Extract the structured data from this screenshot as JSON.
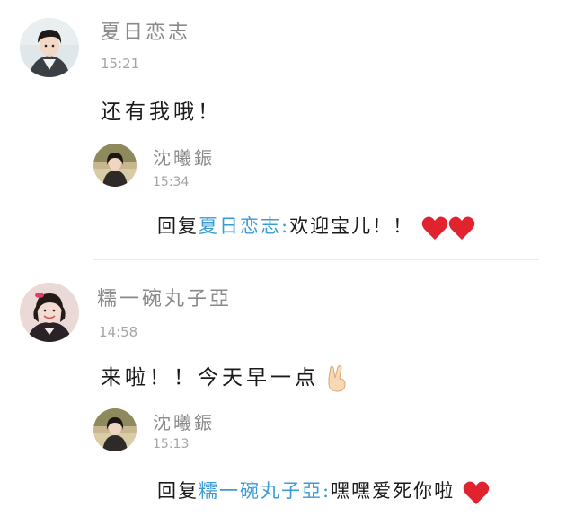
{
  "comments": [
    {
      "author": "夏日恋志",
      "time": "15:21",
      "text": "还有我哦！",
      "avatar": "avatar-boy-photo",
      "reply": {
        "author": "沈曦鋠",
        "time": "15:34",
        "prefix": "回复",
        "mention": "夏日恋志:",
        "text": "欢迎宝儿！！",
        "emoji": [
          "red-heart-icon",
          "red-heart-icon"
        ]
      }
    },
    {
      "author": "糯一碗丸子亞",
      "time": "14:58",
      "text": "来啦！！今天早一点",
      "emoji": "victory-hand-icon",
      "avatar": "avatar-girl-photo",
      "reply": {
        "author": "沈曦鋠",
        "time": "15:13",
        "prefix": "回复",
        "mention": "糯一碗丸子亞:",
        "text": "嘿嘿爱死你啦",
        "emoji": [
          "red-heart-icon"
        ]
      }
    }
  ],
  "colors": {
    "name": "#8a8a8a",
    "time": "#a5a5a5",
    "mention": "#3b9bd6",
    "heart": "#e0232e",
    "divider": "#ececec"
  }
}
